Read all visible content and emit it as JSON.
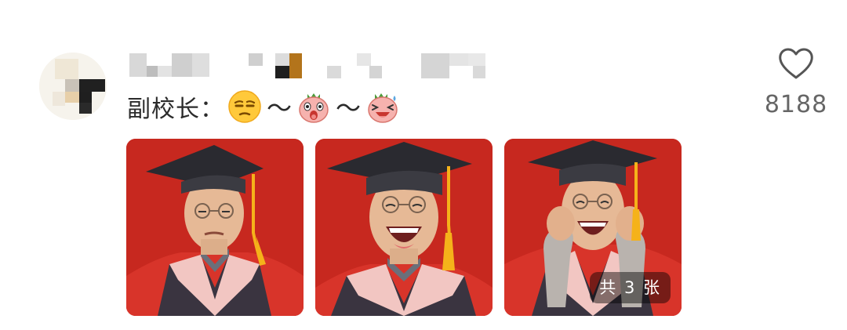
{
  "comment": {
    "prefix": "副校长：",
    "tilde": "～",
    "emojis": [
      "unamused-face-emoji",
      "surprised-pink-character-emoji",
      "laughing-pink-character-emoji"
    ]
  },
  "like": {
    "icon": "heart-outline-icon",
    "count": "8188"
  },
  "images": {
    "count_badge": "共 3 张",
    "items": [
      {
        "alt": "Graduation-gown official, serious face"
      },
      {
        "alt": "Graduation-gown official, laughing"
      },
      {
        "alt": "Graduation-gown official, laughing with fists raised"
      }
    ]
  },
  "colors": {
    "background": "#ffffff",
    "text": "#2b2b2b",
    "muted": "#666666",
    "photo_red": "#c7281f"
  }
}
